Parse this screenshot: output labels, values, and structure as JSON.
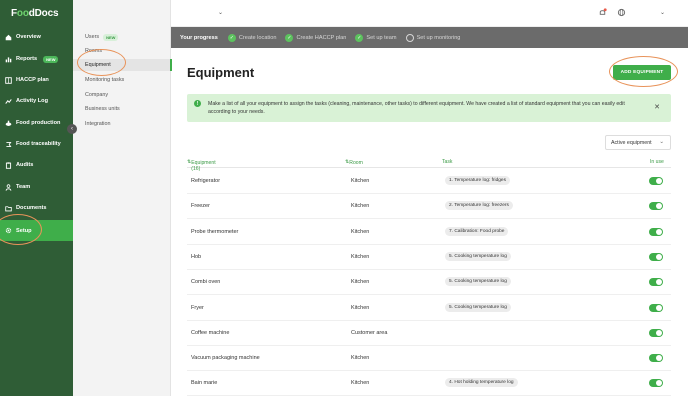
{
  "brand": {
    "prefix": "F",
    "oo": "oo",
    "suffix": "dDocs"
  },
  "sidebar": {
    "items": [
      {
        "label": "Overview",
        "icon": "home-icon",
        "badge": ""
      },
      {
        "label": "Reports",
        "icon": "chart-icon",
        "badge": "NEW"
      },
      {
        "label": "HACCP plan",
        "icon": "book-icon",
        "badge": ""
      },
      {
        "label": "Activity Log",
        "icon": "chart-line-icon",
        "badge": ""
      },
      {
        "label": "Food production",
        "icon": "pan-icon",
        "badge": ""
      },
      {
        "label": "Food traceability",
        "icon": "trace-icon",
        "badge": ""
      },
      {
        "label": "Audits",
        "icon": "clipboard-icon",
        "badge": ""
      },
      {
        "label": "Team",
        "icon": "person-icon",
        "badge": ""
      },
      {
        "label": "Documents",
        "icon": "folder-icon",
        "badge": ""
      },
      {
        "label": "Setup",
        "icon": "gear-icon",
        "badge": ""
      }
    ]
  },
  "subnav": {
    "items": [
      {
        "label": "Users",
        "badge": "NEW"
      },
      {
        "label": "Rooms",
        "badge": ""
      },
      {
        "label": "Equipment",
        "badge": ""
      },
      {
        "label": "Monitoring tasks",
        "badge": ""
      },
      {
        "label": "Company",
        "badge": ""
      },
      {
        "label": "Business units",
        "badge": ""
      },
      {
        "label": "Integration",
        "badge": ""
      }
    ]
  },
  "progress": {
    "title": "Your progress",
    "steps": [
      {
        "label": "Create location",
        "done": true
      },
      {
        "label": "Create HACCP plan",
        "done": true
      },
      {
        "label": "Set up team",
        "done": true
      },
      {
        "label": "Set up monitoring",
        "done": false
      }
    ]
  },
  "page": {
    "title": "Equipment",
    "add_button": "ADD EQUIPMENT",
    "info_text": "Make a list of all your equipment to assign the tasks (cleaning, maintenance, other tasks) to different equipment. We have created a list of standard equipment that you can easily edit according to your needs.",
    "filter_value": "Active equipment"
  },
  "table": {
    "headers": {
      "equipment": "Equipment (16)",
      "room": "Room",
      "task": "Task",
      "in_use": "In use"
    },
    "rows": [
      {
        "name": "Refrigerator",
        "room": "Kitchen",
        "task": "1. Temperature log: fridges",
        "in_use": true
      },
      {
        "name": "Freezer",
        "room": "Kitchen",
        "task": "2. Temperature log: freezers",
        "in_use": true
      },
      {
        "name": "Probe thermometer",
        "room": "Kitchen",
        "task": "7. Calibration: Food probe",
        "in_use": true
      },
      {
        "name": "Hob",
        "room": "Kitchen",
        "task": "5. Cooking temperature log",
        "in_use": true
      },
      {
        "name": "Combi oven",
        "room": "Kitchen",
        "task": "5. Cooking temperature log",
        "in_use": true
      },
      {
        "name": "Fryer",
        "room": "Kitchen",
        "task": "5. Cooking temperature log",
        "in_use": true
      },
      {
        "name": "Coffee machine",
        "room": "Customer area",
        "task": "",
        "in_use": true
      },
      {
        "name": "Vacuum packaging machine",
        "room": "Kitchen",
        "task": "",
        "in_use": true
      },
      {
        "name": "Bain marie",
        "room": "Kitchen",
        "task": "4. Hot holding temperature log",
        "in_use": true
      }
    ]
  },
  "colors": {
    "sidebar": "#2f5d36",
    "accent": "#3fae4a",
    "progress_bg": "#6b6b6b",
    "info_bg": "#d9f2d6",
    "annotation": "#e8935a"
  }
}
